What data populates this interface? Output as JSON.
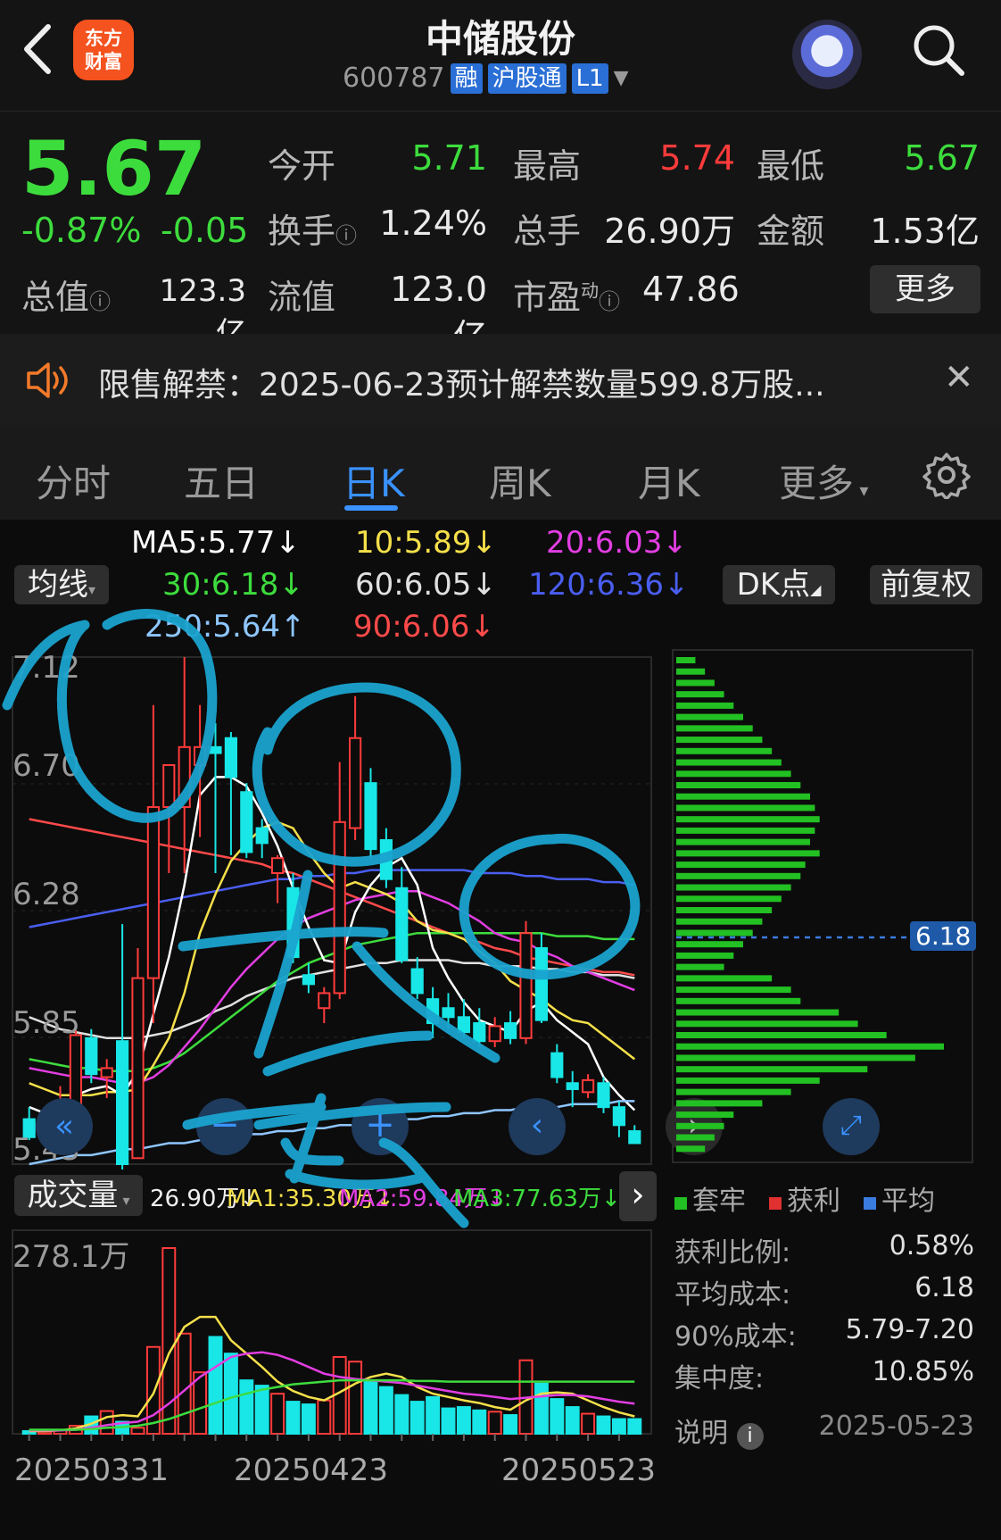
{
  "header": {
    "back_icon": "chevron-left-icon",
    "logo_text_line1": "东方",
    "logo_text_line2": "财富",
    "stock_name": "中储股份",
    "stock_code": "600787",
    "tags": [
      "融",
      "沪股通",
      "L1"
    ],
    "robot_icon": "robot-avatar-icon",
    "search_icon": "search-icon"
  },
  "quote": {
    "price": "5.67",
    "change_pct": "-0.87%",
    "change": "-0.05",
    "open_label": "今开",
    "open": "5.71",
    "high_label": "最高",
    "high": "5.74",
    "low_label": "最低",
    "low": "5.67",
    "turnover_label": "换手",
    "turnover": "1.24%",
    "volume_label": "总手",
    "volume": "26.90万",
    "amount_label": "金额",
    "amount": "1.53亿",
    "total_cap_label": "总值",
    "total_cap": "123.3亿",
    "float_cap_label": "流值",
    "float_cap": "123.0亿",
    "pe_label": "市盈",
    "pe_sup": "动",
    "pe": "47.86",
    "more_label": "更多"
  },
  "notice": {
    "icon": "speaker-icon",
    "text": "限售解禁：2025-06-23预计解禁数量599.8万股...",
    "close_icon": "close-icon"
  },
  "tabs": {
    "items": [
      "分时",
      "五日",
      "日K",
      "周K",
      "月K",
      "更多"
    ],
    "active": "日K",
    "settings_icon": "gear-icon"
  },
  "ma_legend": {
    "ma5": "MA5:5.77↓",
    "ma10": "10:5.89↓",
    "ma20": "20:6.03↓",
    "ma30": "30:6.18↓",
    "ma60": "60:6.05↓",
    "ma120": "120:6.36↓",
    "ma250": "250:5.64↑",
    "ma90": "90:6.06↓",
    "indicator_select": "均线",
    "dk_button": "DK点",
    "adjust_button": "前复权"
  },
  "colors": {
    "up": "#ff3b3b",
    "down": "#19e6e6",
    "ma5": "#ffffff",
    "ma10": "#f5e04a",
    "ma20": "#e23ee2",
    "ma30": "#3ddc3d",
    "ma60": "#e0e0e0",
    "ma120": "#4a5ef0",
    "ma250": "#8ec6ff",
    "ma90": "#ff4a4a",
    "annotation": "#1aa3cf"
  },
  "chart_data": {
    "type": "candlestick",
    "y_axis_labels": [
      "7.12",
      "6.70",
      "6.28",
      "5.85",
      "5.43"
    ],
    "ylim": [
      5.43,
      7.12
    ],
    "candles": [
      {
        "o": 5.58,
        "h": 5.62,
        "l": 5.51,
        "c": 5.52
      },
      {
        "o": 5.53,
        "h": 5.61,
        "l": 5.53,
        "c": 5.59
      },
      {
        "o": 5.58,
        "h": 5.69,
        "l": 5.55,
        "c": 5.63
      },
      {
        "o": 5.62,
        "h": 5.88,
        "l": 5.6,
        "c": 5.86
      },
      {
        "o": 5.85,
        "h": 5.88,
        "l": 5.7,
        "c": 5.73
      },
      {
        "o": 5.72,
        "h": 5.78,
        "l": 5.65,
        "c": 5.75
      },
      {
        "o": 5.84,
        "h": 6.23,
        "l": 5.41,
        "c": 5.43
      },
      {
        "o": 5.45,
        "h": 6.15,
        "l": 5.45,
        "c": 6.05
      },
      {
        "o": 6.05,
        "h": 6.96,
        "l": 5.9,
        "c": 6.62
      },
      {
        "o": 6.62,
        "h": 6.73,
        "l": 6.4,
        "c": 6.76
      },
      {
        "o": 6.62,
        "h": 7.12,
        "l": 6.4,
        "c": 6.82
      },
      {
        "o": 6.76,
        "h": 6.96,
        "l": 6.52,
        "c": 6.82
      },
      {
        "o": 6.82,
        "h": 6.9,
        "l": 6.4,
        "c": 6.8
      },
      {
        "o": 6.85,
        "h": 6.87,
        "l": 6.46,
        "c": 6.72
      },
      {
        "o": 6.67,
        "h": 6.7,
        "l": 6.45,
        "c": 6.47
      },
      {
        "o": 6.55,
        "h": 6.58,
        "l": 6.45,
        "c": 6.5
      },
      {
        "o": 6.4,
        "h": 6.46,
        "l": 6.3,
        "c": 6.45
      },
      {
        "o": 6.35,
        "h": 6.4,
        "l": 6.1,
        "c": 6.12
      },
      {
        "o": 6.06,
        "h": 6.1,
        "l": 6.0,
        "c": 6.03
      },
      {
        "o": 5.95,
        "h": 6.02,
        "l": 5.9,
        "c": 6.0
      },
      {
        "o": 6.0,
        "h": 6.77,
        "l": 5.98,
        "c": 6.57
      },
      {
        "o": 6.55,
        "h": 6.99,
        "l": 6.51,
        "c": 6.85
      },
      {
        "o": 6.7,
        "h": 6.75,
        "l": 6.45,
        "c": 6.48
      },
      {
        "o": 6.51,
        "h": 6.55,
        "l": 6.35,
        "c": 6.38
      },
      {
        "o": 6.35,
        "h": 6.42,
        "l": 6.1,
        "c": 6.11
      },
      {
        "o": 6.08,
        "h": 6.12,
        "l": 5.98,
        "c": 6.0
      },
      {
        "o": 5.98,
        "h": 6.02,
        "l": 5.85,
        "c": 5.9
      },
      {
        "o": 5.95,
        "h": 6.0,
        "l": 5.88,
        "c": 5.92
      },
      {
        "o": 5.92,
        "h": 5.98,
        "l": 5.85,
        "c": 5.87
      },
      {
        "o": 5.9,
        "h": 5.95,
        "l": 5.82,
        "c": 5.84
      },
      {
        "o": 5.84,
        "h": 5.92,
        "l": 5.82,
        "c": 5.89
      },
      {
        "o": 5.9,
        "h": 5.94,
        "l": 5.83,
        "c": 5.85
      },
      {
        "o": 5.85,
        "h": 6.24,
        "l": 5.83,
        "c": 6.2
      },
      {
        "o": 6.15,
        "h": 6.2,
        "l": 5.9,
        "c": 5.91
      },
      {
        "o": 5.8,
        "h": 5.83,
        "l": 5.7,
        "c": 5.72
      },
      {
        "o": 5.7,
        "h": 5.74,
        "l": 5.62,
        "c": 5.68
      },
      {
        "o": 5.67,
        "h": 5.73,
        "l": 5.65,
        "c": 5.71
      },
      {
        "o": 5.7,
        "h": 5.72,
        "l": 5.6,
        "c": 5.62
      },
      {
        "o": 5.62,
        "h": 5.64,
        "l": 5.52,
        "c": 5.56
      },
      {
        "o": 5.54,
        "h": 5.56,
        "l": 5.5,
        "c": 5.5
      }
    ],
    "ma_lines": {
      "ma5": [
        5.62,
        5.6,
        5.6,
        5.66,
        5.68,
        5.69,
        5.66,
        5.74,
        5.93,
        6.12,
        6.36,
        6.66,
        6.72,
        6.72,
        6.69,
        6.6,
        6.49,
        6.35,
        6.22,
        6.11,
        6.1,
        6.27,
        6.36,
        6.42,
        6.45,
        6.36,
        6.15,
        6.05,
        5.97,
        5.91,
        5.89,
        5.87,
        5.94,
        5.97,
        5.91,
        5.87,
        5.83,
        5.72,
        5.66,
        5.61
      ],
      "ma10": [
        5.7,
        5.68,
        5.66,
        5.66,
        5.66,
        5.67,
        5.67,
        5.68,
        5.76,
        5.85,
        6.0,
        6.2,
        6.33,
        6.44,
        6.5,
        6.55,
        6.57,
        6.55,
        6.47,
        6.4,
        6.35,
        6.37,
        6.35,
        6.33,
        6.3,
        6.24,
        6.21,
        6.2,
        6.18,
        6.14,
        6.1,
        6.04,
        6.01,
        5.98,
        5.94,
        5.91,
        5.9,
        5.86,
        5.82,
        5.78
      ],
      "ma20": [
        5.75,
        5.74,
        5.73,
        5.72,
        5.72,
        5.71,
        5.7,
        5.7,
        5.72,
        5.76,
        5.82,
        5.88,
        5.95,
        6.02,
        6.08,
        6.13,
        6.18,
        6.22,
        6.25,
        6.27,
        6.29,
        6.31,
        6.32,
        6.33,
        6.34,
        6.34,
        6.32,
        6.3,
        6.27,
        6.24,
        6.2,
        6.18,
        6.17,
        6.14,
        6.12,
        6.09,
        6.07,
        6.05,
        6.03,
        6.01
      ],
      "ma30": [
        5.78,
        5.77,
        5.76,
        5.75,
        5.75,
        5.74,
        5.74,
        5.74,
        5.75,
        5.77,
        5.8,
        5.84,
        5.88,
        5.92,
        5.96,
        6.0,
        6.04,
        6.07,
        6.1,
        6.12,
        6.14,
        6.16,
        6.17,
        6.18,
        6.19,
        6.2,
        6.2,
        6.2,
        6.2,
        6.2,
        6.2,
        6.2,
        6.2,
        6.2,
        6.19,
        6.19,
        6.19,
        6.18,
        6.18,
        6.18
      ],
      "ma60": [
        5.92,
        5.9,
        5.88,
        5.87,
        5.86,
        5.85,
        5.85,
        5.85,
        5.86,
        5.87,
        5.89,
        5.91,
        5.94,
        5.96,
        5.99,
        6.01,
        6.03,
        6.05,
        6.06,
        6.07,
        6.08,
        6.09,
        6.1,
        6.1,
        6.11,
        6.11,
        6.11,
        6.11,
        6.1,
        6.1,
        6.09,
        6.09,
        6.09,
        6.08,
        6.08,
        6.07,
        6.07,
        6.06,
        6.06,
        6.05
      ],
      "ma90": [
        6.58,
        6.57,
        6.56,
        6.55,
        6.54,
        6.53,
        6.52,
        6.51,
        6.5,
        6.49,
        6.48,
        6.47,
        6.46,
        6.45,
        6.44,
        6.43,
        6.41,
        6.4,
        6.38,
        6.36,
        6.34,
        6.32,
        6.3,
        6.28,
        6.26,
        6.24,
        6.22,
        6.2,
        6.18,
        6.17,
        6.15,
        6.14,
        6.12,
        6.11,
        6.1,
        6.09,
        6.08,
        6.07,
        6.07,
        6.06
      ],
      "ma120": [
        6.22,
        6.23,
        6.24,
        6.25,
        6.26,
        6.27,
        6.28,
        6.29,
        6.3,
        6.31,
        6.32,
        6.33,
        6.34,
        6.35,
        6.36,
        6.37,
        6.38,
        6.38,
        6.39,
        6.39,
        6.4,
        6.4,
        6.41,
        6.41,
        6.41,
        6.41,
        6.41,
        6.41,
        6.41,
        6.4,
        6.4,
        6.4,
        6.39,
        6.39,
        6.38,
        6.38,
        6.38,
        6.37,
        6.37,
        6.36
      ],
      "ma250": [
        5.43,
        5.44,
        5.45,
        5.46,
        5.46,
        5.47,
        5.48,
        5.48,
        5.49,
        5.5,
        5.5,
        5.51,
        5.51,
        5.52,
        5.53,
        5.53,
        5.54,
        5.54,
        5.55,
        5.55,
        5.56,
        5.56,
        5.57,
        5.57,
        5.58,
        5.58,
        5.59,
        5.59,
        5.6,
        5.6,
        5.61,
        5.61,
        5.62,
        5.62,
        5.62,
        5.63,
        5.63,
        5.63,
        5.64,
        5.64
      ]
    },
    "volume_label": "成交量",
    "volume_summary": "26.90万↓",
    "vol_ma1": "MA1:35.30万↓",
    "vol_ma2": "MA2:59.84万↓",
    "vol_ma3": "MA3:77.63万↓",
    "volume_max_label": "278.1万",
    "volumes": [
      4,
      3,
      6,
      12,
      26,
      34,
      18,
      9,
      130,
      278,
      150,
      92,
      145,
      120,
      80,
      72,
      60,
      48,
      44,
      50,
      115,
      108,
      78,
      70,
      58,
      48,
      55,
      38,
      40,
      35,
      33,
      28,
      110,
      75,
      52,
      40,
      30,
      26,
      22,
      22
    ],
    "vol_ma_lines": {
      "ma1": [
        4,
        4,
        5,
        8,
        15,
        25,
        28,
        26,
        60,
        120,
        160,
        175,
        175,
        140,
        120,
        100,
        78,
        64,
        55,
        50,
        62,
        75,
        85,
        90,
        85,
        70,
        60,
        55,
        50,
        46,
        40,
        36,
        50,
        60,
        62,
        60,
        50,
        40,
        32,
        26
      ],
      "ma2": [
        5,
        5,
        5,
        6,
        9,
        13,
        16,
        18,
        28,
        45,
        65,
        85,
        100,
        115,
        120,
        122,
        118,
        110,
        100,
        90,
        85,
        82,
        80,
        78,
        76,
        72,
        68,
        64,
        60,
        58,
        55,
        52,
        54,
        56,
        58,
        58,
        56,
        52,
        48,
        45
      ],
      "ma3": [
        6,
        6,
        6,
        6,
        7,
        9,
        10,
        12,
        16,
        22,
        30,
        38,
        46,
        54,
        60,
        66,
        70,
        74,
        76,
        78,
        80,
        80,
        80,
        80,
        80,
        79,
        79,
        78,
        78,
        78,
        78,
        78,
        78,
        78,
        78,
        78,
        78,
        78,
        78,
        78
      ]
    },
    "x_labels": [
      "20250331",
      "20250423",
      "20250523"
    ]
  },
  "chips": {
    "price_marker": "6.18",
    "chip_bars": [
      4,
      6,
      8,
      10,
      12,
      14,
      16,
      18,
      20,
      22,
      24,
      26,
      28,
      29,
      30,
      29,
      28,
      30,
      27,
      26,
      24,
      22,
      20,
      18,
      16,
      14,
      12,
      10,
      20,
      24,
      26,
      34,
      38,
      44,
      56,
      50,
      40,
      30,
      24,
      18,
      12,
      10,
      8,
      6
    ],
    "legend": [
      "套牢",
      "获利",
      "平均"
    ],
    "legend_colors": [
      "#22c022",
      "#e03030",
      "#3a7be0"
    ],
    "stats": [
      {
        "label": "获利比例:",
        "value": "0.58%"
      },
      {
        "label": "平均成本:",
        "value": "6.18"
      },
      {
        "label": "90%成本:",
        "value": "5.79-7.20"
      },
      {
        "label": "集中度:",
        "value": "10.85%"
      }
    ],
    "note_label": "说明",
    "date": "2025-05-23"
  },
  "nav_buttons": [
    "double-left-icon",
    "zoom-out-icon",
    "zoom-in-icon",
    "chevron-left-icon",
    "chevron-right-icon",
    "expand-icon"
  ]
}
